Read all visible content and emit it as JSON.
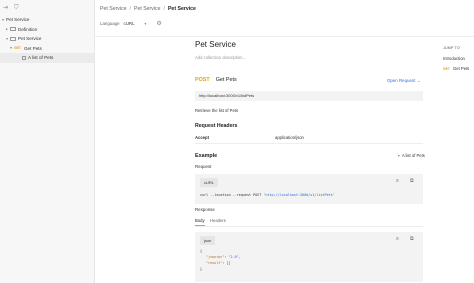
{
  "sidebar": {
    "items": [
      {
        "label": "Pet Service",
        "level": 0
      },
      {
        "label": "Definition",
        "level": 1
      },
      {
        "label": "Pet Service",
        "level": 1
      },
      {
        "label": "Get Pets",
        "method": "GET",
        "level": 2
      },
      {
        "label": "A list of Pets",
        "level": 3
      }
    ]
  },
  "header": {
    "breadcrumb": [
      "Pet Service",
      "Pet Service",
      "Pet Service"
    ],
    "language_label": "Language",
    "language_value": "cURL"
  },
  "main": {
    "title": "Pet Service",
    "description_placeholder": "Add collection description...",
    "request": {
      "method": "POST",
      "name": "Get Pets",
      "open_label": "Open Request →",
      "url": "http://localhost:3000/v1/listPets",
      "description": "Retrieve the list of Pets"
    },
    "request_headers_title": "Request Headers",
    "headers": [
      {
        "key": "Accept",
        "value": "application/json"
      }
    ],
    "example": {
      "title": "Example",
      "selected": "A list of Pets",
      "request_label": "Request",
      "request_lang": "cURL",
      "curl_line": {
        "prefix": "curl --location --request POST '",
        "url": "http://localhost:3000/v1/listPets",
        "suffix": "'"
      },
      "response_label": "Response",
      "tabs": [
        "Body",
        "Headers"
      ],
      "response_lang": "json",
      "json_lines": [
        {
          "text": "{",
          "kind": "plain"
        },
        {
          "key": "\"jsonrpc\"",
          "value": "\"2.0\","
        },
        {
          "key": "\"result\"",
          "value": "[]"
        },
        {
          "text": "}",
          "kind": "plain"
        }
      ]
    }
  },
  "jump_to": {
    "header": "JUMP TO",
    "items": [
      {
        "label": "Introduction"
      },
      {
        "label": "Get Pets",
        "method": "GET"
      }
    ]
  },
  "colors": {
    "post": "#e8a100",
    "get": "#e8a100",
    "link": "#3a6fd8",
    "string": "#2a6ad3"
  }
}
